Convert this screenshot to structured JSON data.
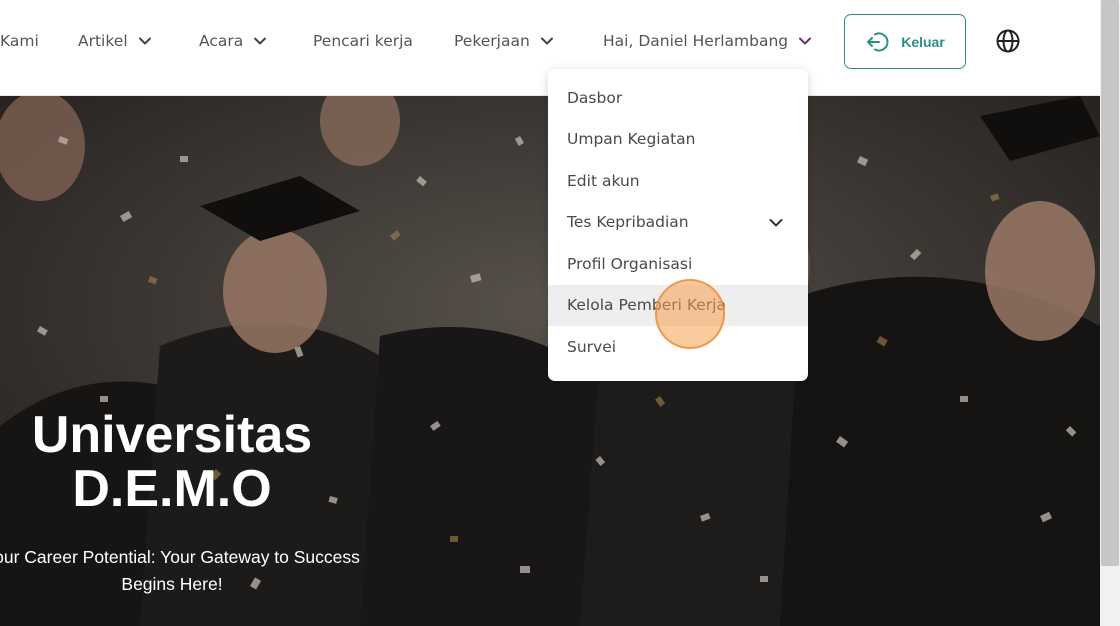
{
  "nav": {
    "kami": "Kami",
    "artikel": "Artikel",
    "acara": "Acara",
    "pencari_kerja": "Pencari kerja",
    "pekerjaan": "Pekerjaan",
    "user_greeting": "Hai, Daniel Herlambang",
    "logout_label": "Keluar",
    "language_icon": "globe-icon"
  },
  "user_menu": {
    "items": [
      {
        "label": "Dasbor"
      },
      {
        "label": "Umpan Kegiatan"
      },
      {
        "label": "Edit akun"
      },
      {
        "label": "Tes Kepribadian"
      },
      {
        "label": "Profil Organisasi"
      },
      {
        "label": "Kelola Pemberi Kerja"
      },
      {
        "label": "Survei"
      }
    ],
    "active_item": "Kelola Pemberi Kerja"
  },
  "hero": {
    "title": "Universitas D.E.M.O",
    "subtitle": "Your Career Potential: Your Gateway to Success Begins Here!"
  },
  "colors": {
    "accent": "#2a8f8c",
    "text": "#555555",
    "cursor_highlight": "#f5a050"
  }
}
